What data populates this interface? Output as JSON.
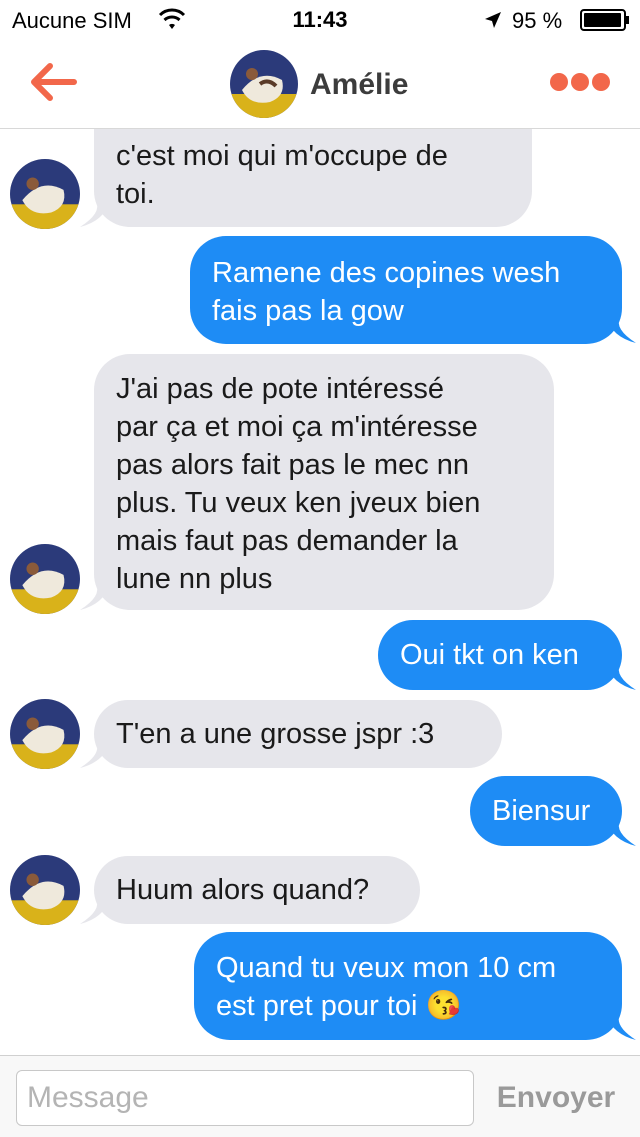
{
  "status_bar": {
    "carrier": "Aucune SIM",
    "time": "11:43",
    "battery": "95 %"
  },
  "header": {
    "back_icon": "arrow-left-icon",
    "contact_name": "Amélie",
    "more_icon": "three-dots-icon",
    "accent_color": "#f2674a"
  },
  "messages": [
    {
      "from": "contact",
      "text": "c'est moi qui m'occupe de\ntoi."
    },
    {
      "from": "me",
      "text": "Ramene des copines wesh\nfais pas la gow"
    },
    {
      "from": "contact",
      "text": "J'ai pas de pote intéressé\npar ça et moi ça m'intéresse\npas alors fait pas le mec nn\nplus.  Tu veux ken jveux bien\nmais faut pas demander la\nlune nn plus"
    },
    {
      "from": "me",
      "text": "Oui tkt on ken"
    },
    {
      "from": "contact",
      "text": "T'en a  une grosse jspr :3"
    },
    {
      "from": "me",
      "text": "Biensur"
    },
    {
      "from": "contact",
      "text": "Huum alors quand?"
    },
    {
      "from": "me",
      "text": "Quand tu veux mon 10 cm\nest pret pour toi 😘"
    }
  ],
  "composer": {
    "placeholder": "Message",
    "value": "",
    "send_label": "Envoyer"
  },
  "colors": {
    "outgoing_bubble": "#1e8cf5",
    "incoming_bubble": "#e6e6eb"
  }
}
